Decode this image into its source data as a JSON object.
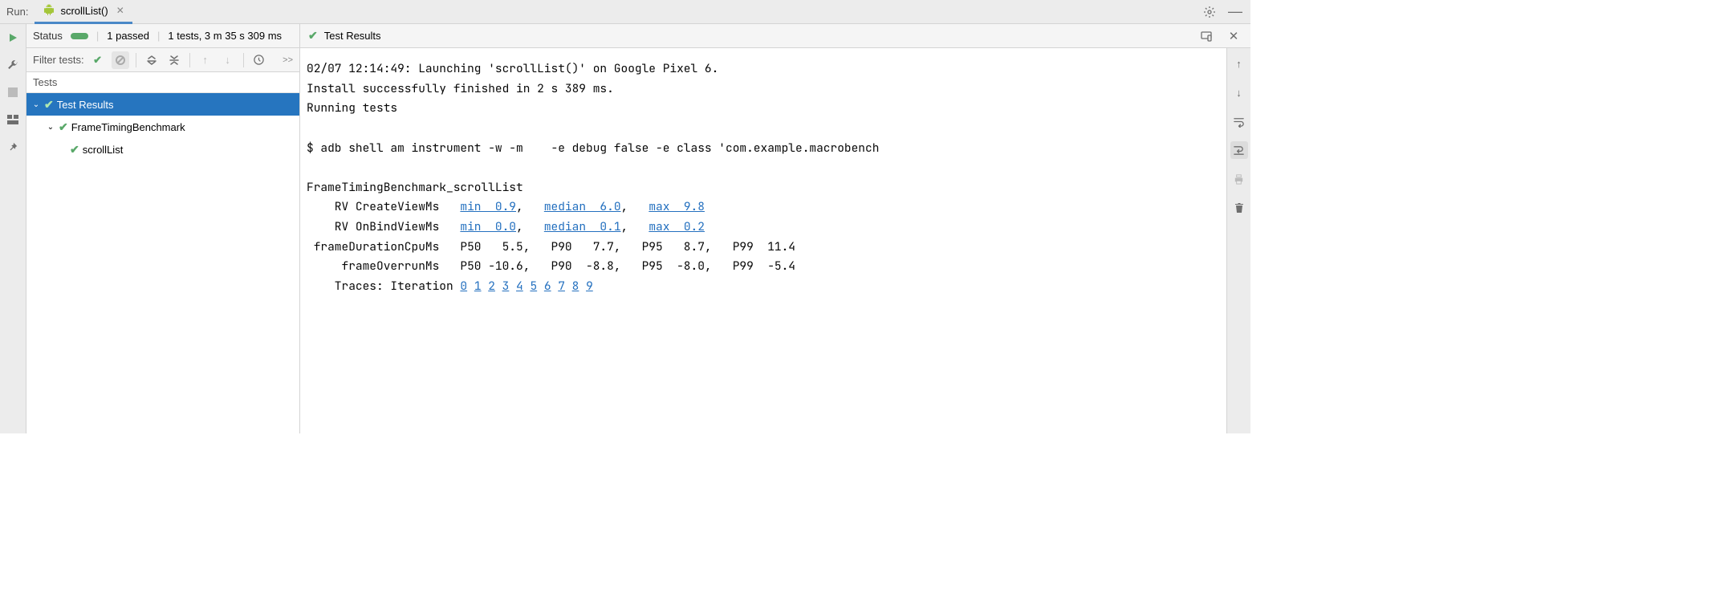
{
  "top": {
    "run_label": "Run:",
    "tab_name": "scrollList()"
  },
  "status_bar": {
    "status_label": "Status",
    "passed": "1 passed",
    "summary": "1 tests, 3 m 35 s 309 ms"
  },
  "filter_bar": {
    "label": "Filter tests:"
  },
  "tree": {
    "header": "Tests",
    "root": "Test Results",
    "class_name": "FrameTimingBenchmark",
    "test_name": "scrollList"
  },
  "results_header": {
    "title": "Test Results"
  },
  "console": {
    "line1": "02/07 12:14:49: Launching 'scrollList()' on Google Pixel 6.",
    "line2": "Install successfully finished in 2 s 389 ms.",
    "line3": "Running tests",
    "line5": "$ adb shell am instrument -w -m    -e debug false -e class 'com.example.macrobench",
    "line7": "FrameTimingBenchmark_scrollList",
    "rv_create_label": "    RV CreateViewMs   ",
    "rv_create_min": "min  0.9",
    "rv_create_median": "median  6.0",
    "rv_create_max": "max  9.8",
    "rv_bind_label": "    RV OnBindViewMs   ",
    "rv_bind_min": "min  0.0",
    "rv_bind_median": "median  0.1",
    "rv_bind_max": "max  0.2",
    "line10": " frameDurationCpuMs   P50   5.5,   P90   7.7,   P95   8.7,   P99  11.4",
    "line11": "     frameOverrunMs   P50 -10.6,   P90  -8.8,   P95  -8.0,   P99  -5.4",
    "traces_label": "    Traces: Iteration ",
    "iterations": [
      "0",
      "1",
      "2",
      "3",
      "4",
      "5",
      "6",
      "7",
      "8",
      "9"
    ]
  },
  "chart_data": {
    "type": "table",
    "title": "FrameTimingBenchmark_scrollList",
    "series": [
      {
        "name": "RV CreateViewMs",
        "min": 0.9,
        "median": 6.0,
        "max": 9.8
      },
      {
        "name": "RV OnBindViewMs",
        "min": 0.0,
        "median": 0.1,
        "max": 0.2
      },
      {
        "name": "frameDurationCpuMs",
        "P50": 5.5,
        "P90": 7.7,
        "P95": 8.7,
        "P99": 11.4
      },
      {
        "name": "frameOverrunMs",
        "P50": -10.6,
        "P90": -8.8,
        "P95": -8.0,
        "P99": -5.4
      }
    ],
    "trace_iterations": [
      0,
      1,
      2,
      3,
      4,
      5,
      6,
      7,
      8,
      9
    ]
  }
}
